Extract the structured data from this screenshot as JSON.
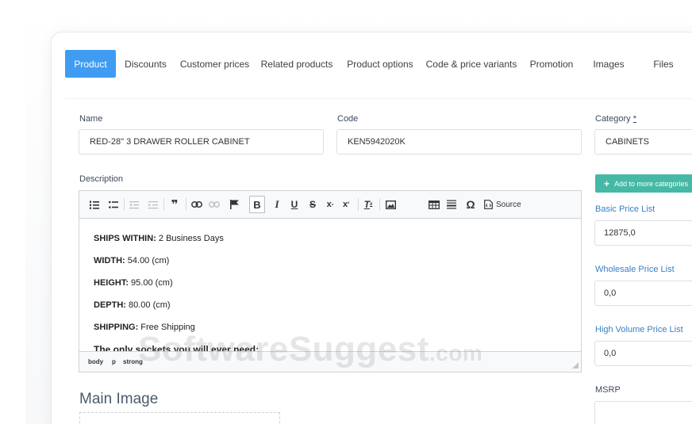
{
  "tabs": [
    {
      "label": "Product",
      "active": true
    },
    {
      "label": "Discounts"
    },
    {
      "label": "Customer prices"
    },
    {
      "label": "Related products"
    },
    {
      "label": "Product options"
    },
    {
      "label": "Code & price variants"
    },
    {
      "label": "Promotion"
    },
    {
      "label": "Images"
    },
    {
      "label": "Files"
    }
  ],
  "form": {
    "name_label": "Name",
    "name_value": "RED-28\" 3 DRAWER ROLLER CABINET",
    "code_label": "Code",
    "code_value": "KEN5942020K",
    "category_label": "Category",
    "category_required": "*",
    "category_value": "CABINETS",
    "description_label": "Description",
    "add_category_label": "Add to more categories",
    "basic_price_label": "Basic Price List",
    "basic_price_value": "12875,0",
    "wholesale_price_label": "Wholesale Price List",
    "wholesale_price_value": "0,0",
    "high_volume_label": "High Volume Price List",
    "high_volume_value": "0,0",
    "msrp_label": "MSRP",
    "msrp_value": ""
  },
  "editor": {
    "toolbar": {
      "source_label": "Source",
      "bold": "B",
      "italic": "I",
      "underline": "U",
      "strike": "S",
      "omega": "Ω"
    },
    "lines": [
      {
        "key": "SHIPS WITHIN:",
        "value": " 2 Business Days"
      },
      {
        "key": "WIDTH:",
        "value": " 54.00 (cm)"
      },
      {
        "key": "HEIGHT:",
        "value": " 95.00 (cm)"
      },
      {
        "key": "DEPTH:",
        "value": " 80.00 (cm)"
      },
      {
        "key": "SHIPPING:",
        "value": " Free Shipping"
      },
      {
        "key": "The only sockets you will ever need:",
        "value": ""
      }
    ],
    "path": [
      "body",
      "p",
      "strong"
    ]
  },
  "main_image_heading": "Main Image",
  "watermark": {
    "main": "SoftwareSuggest",
    "suffix": ".com"
  },
  "colors": {
    "active_tab": "#3f9cf2",
    "add_button": "#45b9a6",
    "link_label": "#3a7fc7"
  }
}
